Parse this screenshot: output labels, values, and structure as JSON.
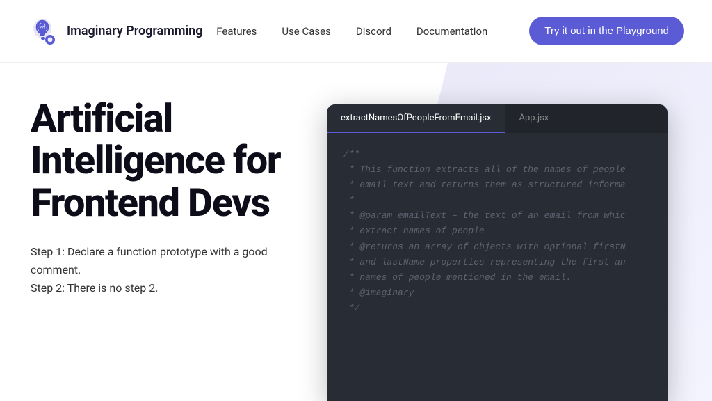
{
  "nav": {
    "brand_text": "Imaginary Programming",
    "links": [
      {
        "label": "Features",
        "id": "features"
      },
      {
        "label": "Use Cases",
        "id": "use-cases"
      },
      {
        "label": "Discord",
        "id": "discord"
      },
      {
        "label": "Documentation",
        "id": "documentation"
      }
    ],
    "cta_label": "Try it out in the Playground"
  },
  "hero": {
    "title": "Artificial Intelligence for Frontend Devs",
    "step1": "Step 1: Declare a function prototype with a good comment.",
    "step2": "Step 2: There is no step 2."
  },
  "code": {
    "tab_active": "extractNamesOfPeopleFromEmail.jsx",
    "tab_inactive": "App.jsx",
    "lines": [
      "/**",
      " * This function extracts all of the names of people",
      " * email text and returns them as structured informa",
      " *",
      " * @param emailText – the text of an email from whic",
      " * extract names of people",
      " * @returns an array of objects with optional firstN",
      " * and lastName properties representing the first an",
      " * names of people mentioned in the email.",
      " * @imaginary",
      " */"
    ]
  }
}
